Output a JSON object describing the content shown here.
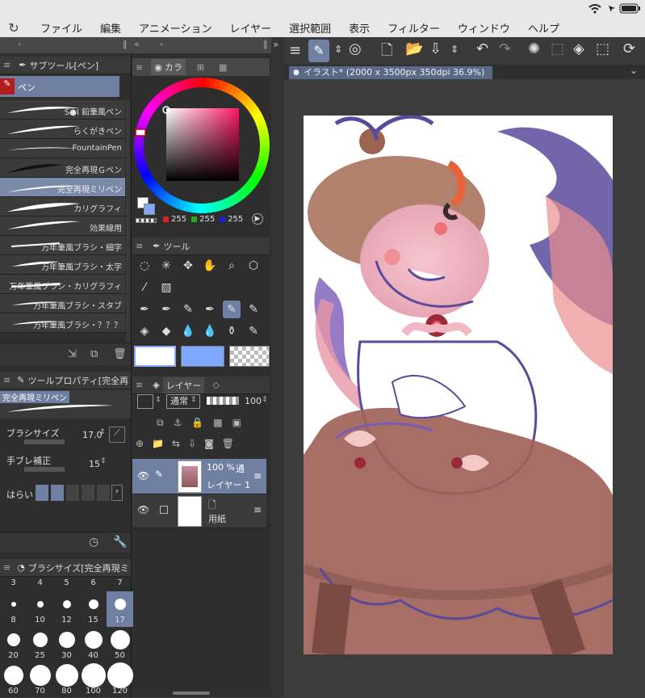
{
  "menu": {
    "items": [
      "ファイル",
      "編集",
      "アニメーション",
      "レイヤー",
      "選択範囲",
      "表示",
      "フィルター",
      "ウィンドウ",
      "ヘルプ"
    ]
  },
  "subtool": {
    "title": "サブツール[ペン]",
    "group_label": "ペン",
    "brushes": [
      {
        "label": "S●I 鉛筆風ペン"
      },
      {
        "label": "らくがきペン"
      },
      {
        "label": "FountainPen"
      },
      {
        "label": "完全再現Ｇペン"
      },
      {
        "label": "完全再現ミリペン",
        "selected": true
      },
      {
        "label": "カリグラフィ"
      },
      {
        "label": "効果線用"
      },
      {
        "label": "万年筆風ブラシ・細字"
      },
      {
        "label": "万年筆風ブラシ・太字"
      },
      {
        "label": "万年筆風ブラシ・カリグラフィ"
      },
      {
        "label": "万年筆風ブラシ・スタブ"
      },
      {
        "label": "万年筆風ブラシ・？？？"
      }
    ]
  },
  "color": {
    "tab_label": "カラ",
    "r": "255",
    "g": "255",
    "b": "255",
    "main_color": "#ffffff",
    "sub_color": "#7fa7ff"
  },
  "tool": {
    "title": "ツール"
  },
  "toolprop": {
    "title": "ツールプロパティ[完全再",
    "brush_name": "完全再現ミリペン",
    "size_label": "ブラシサイズ",
    "size_value": "17.0",
    "stab_label": "手ブレ補正",
    "stab_value": "15",
    "taper_label": "はらい"
  },
  "layer": {
    "title": "レイヤー",
    "blend": "通常",
    "opacity": "100",
    "layers": [
      {
        "opacity_text": "100 %",
        "mode_text": "通",
        "name": "レイヤー 1"
      },
      {
        "name": "用紙"
      }
    ]
  },
  "brushsize": {
    "title": "ブラシサイズ[完全再現ミ",
    "top_row": [
      "3",
      "4",
      "5",
      "6",
      "7"
    ],
    "row1": [
      "8",
      "10",
      "12",
      "15",
      "17"
    ],
    "row2": [
      "20",
      "25",
      "30",
      "40",
      "50"
    ],
    "row3": [
      "60",
      "70",
      "80",
      "100",
      "120"
    ],
    "selected": "17"
  },
  "document": {
    "tab_label": "イラスト* (2000 x 3500px 350dpi 36.9%)"
  }
}
